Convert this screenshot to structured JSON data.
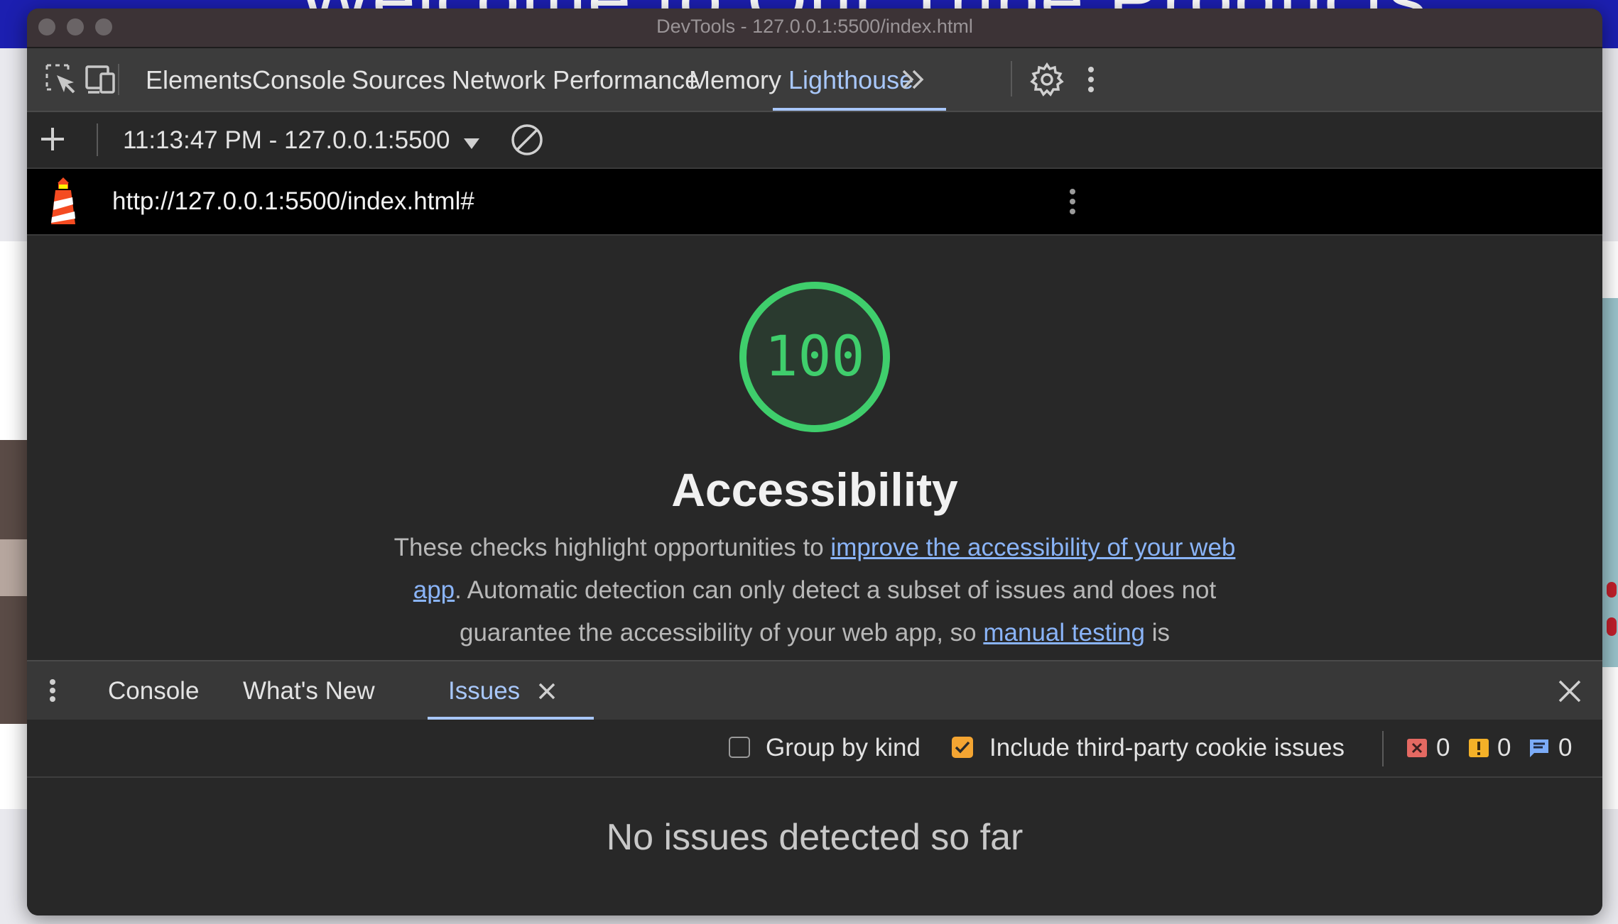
{
  "background_page": {
    "heading": "Welcome to Our Tribe Products"
  },
  "window": {
    "title": "DevTools - 127.0.0.1:5500/index.html"
  },
  "toolbar": {
    "tabs": [
      {
        "label": "Elements",
        "active": false
      },
      {
        "label": "Console",
        "active": false
      },
      {
        "label": "Sources",
        "active": false
      },
      {
        "label": "Network",
        "active": false
      },
      {
        "label": "Performance",
        "active": false
      },
      {
        "label": "Memory",
        "active": false
      },
      {
        "label": "Lighthouse",
        "active": true
      }
    ],
    "icons": [
      "inspect-element-icon",
      "device-toolbar-icon",
      "more-tabs-icon",
      "settings-icon",
      "kebab-menu-icon"
    ]
  },
  "lighthouse": {
    "report_selector": "11:13:47 PM - 127.0.0.1:5500",
    "url": "http://127.0.0.1:5500/index.html#",
    "score": "100",
    "score_fraction": 1.0,
    "category_title": "Accessibility",
    "description": {
      "part1": "These checks highlight opportunities to ",
      "link1": "improve the accessibility of your web app",
      "part2": ". Automatic detection can only detect a subset of issues and does not guarantee the accessibility of your web app, so ",
      "link2": "manual testing",
      "part3": " is"
    },
    "colors": {
      "pass": "#3fce6c"
    }
  },
  "drawer": {
    "tabs": [
      {
        "label": "Console",
        "active": false
      },
      {
        "label": "What's New",
        "active": false
      },
      {
        "label": "Issues",
        "active": true
      }
    ]
  },
  "issues": {
    "group_by_kind": {
      "label": "Group by kind",
      "checked": false
    },
    "include_third_party": {
      "label": "Include third-party cookie issues",
      "checked": true
    },
    "error_count": "0",
    "warning_count": "0",
    "info_count": "0",
    "empty_message": "No issues detected so far"
  }
}
